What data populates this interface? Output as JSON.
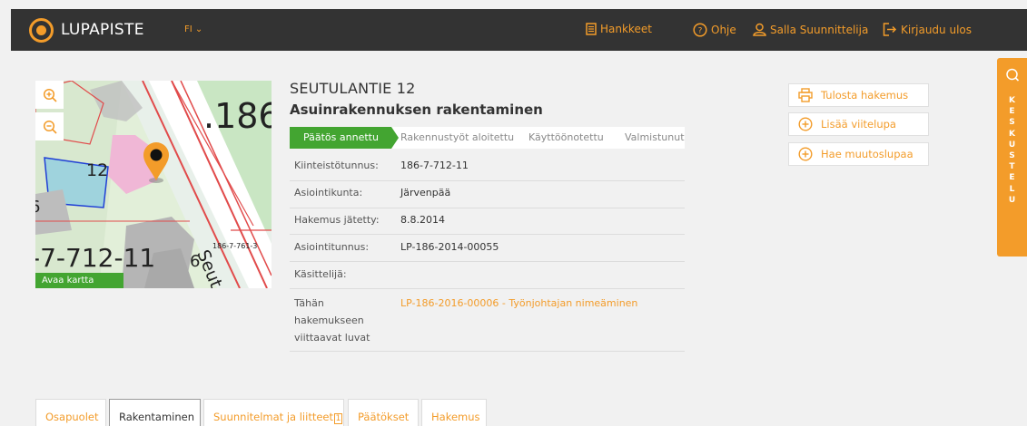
{
  "topbar": {
    "logo_text": "LUPAPISTE",
    "language": "FI ⌄",
    "nav": [
      {
        "label": "Hankkeet",
        "icon": "document-icon"
      },
      {
        "label": "Ohje",
        "icon": "help-icon"
      },
      {
        "label": "Salla Suunnittelija",
        "icon": "user-icon"
      },
      {
        "label": "Kirjaudu ulos",
        "icon": "logout-icon"
      }
    ]
  },
  "map": {
    "open_label": "Avaa kartta",
    "texts": [
      ".186",
      "12",
      "-7-712-11",
      "6",
      "186-7-761-3",
      "Seut",
      "6"
    ]
  },
  "application": {
    "address": "SEUTULANTIE 12",
    "operation": "Asuinrakennuksen rakentaminen"
  },
  "status": {
    "steps": [
      "Päätös annettu",
      "Rakennustyöt aloitettu",
      "Käyttöönotettu",
      "Valmistunut"
    ],
    "active_index": 0
  },
  "info": [
    {
      "label": "Kiinteistötunnus:",
      "value": "186-7-712-11"
    },
    {
      "label": "Asiointikunta:",
      "value": "Järvenpää"
    },
    {
      "label": "Hakemus jätetty:",
      "value": "8.8.2014"
    },
    {
      "label": "Asiointitunnus:",
      "value": "LP-186-2014-00055"
    },
    {
      "label": "Käsittelijä:",
      "value": ""
    },
    {
      "label_lines": [
        "Tähän",
        "hakemukseen",
        "viittaavat luvat"
      ],
      "value": "LP-186-2016-00006 - Työnjohtajan nimeäminen"
    }
  ],
  "actions": [
    {
      "label": "Tulosta hakemus",
      "icon": "print-icon"
    },
    {
      "label": "Lisää viitelupa",
      "icon": "plus-circle-icon"
    },
    {
      "label": "Hae muutoslupaa",
      "icon": "plus-circle-icon"
    }
  ],
  "chat": {
    "letters": [
      "K",
      "E",
      "S",
      "K",
      "U",
      "S",
      "T",
      "E",
      "L",
      "U"
    ],
    "icon": "chat-icon"
  },
  "tabs": [
    {
      "label": "Osapuolet"
    },
    {
      "label": "Rakentaminen",
      "active": true
    },
    {
      "label": "Suunnitelmat ja liitteet",
      "badge": "1"
    },
    {
      "label": "Päätökset"
    },
    {
      "label": "Hakemus"
    }
  ],
  "colors": {
    "accent": "#f39c2a",
    "topbar": "#333333",
    "status_green": "#43a531",
    "background": "#f1f1f1"
  }
}
